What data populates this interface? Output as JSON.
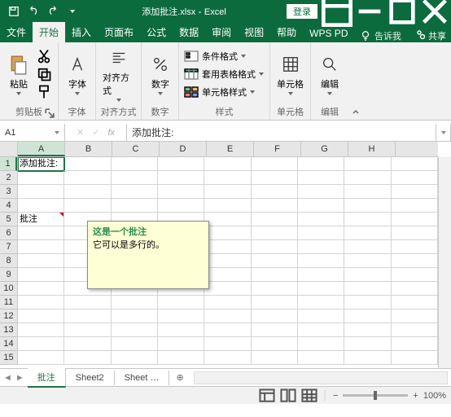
{
  "title": {
    "filename": "添加批注.xlsx",
    "app": "Excel",
    "login": "登录"
  },
  "tabs": {
    "file": "文件",
    "home": "开始",
    "insert": "插入",
    "layout": "页面布",
    "formulas": "公式",
    "data": "数据",
    "review": "审阅",
    "view": "视图",
    "help": "帮助",
    "wps": "WPS PD",
    "tellme": "告诉我",
    "share": "共享"
  },
  "ribbon": {
    "clipboard": {
      "paste": "粘贴",
      "label": "剪贴板"
    },
    "font": {
      "btn": "字体",
      "label": "字体"
    },
    "align": {
      "btn": "对齐方式",
      "label": "对齐方式"
    },
    "number": {
      "btn": "数字",
      "label": "数字"
    },
    "styles": {
      "cond": "条件格式",
      "table": "套用表格格式",
      "cell": "单元格样式",
      "label": "样式"
    },
    "cells": {
      "btn": "单元格",
      "label": "单元格"
    },
    "editing": {
      "btn": "编辑",
      "label": "编辑"
    }
  },
  "namebox": {
    "ref": "A1",
    "fx": "fx",
    "formula": "添加批注:"
  },
  "columns": [
    "A",
    "B",
    "C",
    "D",
    "E",
    "F",
    "G",
    "H"
  ],
  "rows": [
    "1",
    "2",
    "3",
    "4",
    "5",
    "6",
    "7",
    "8",
    "9",
    "10",
    "11",
    "12",
    "13",
    "14",
    "15"
  ],
  "cellA1": "添加批注:",
  "cellA5": "批注",
  "comment": {
    "author": "这是一个批注",
    "body": "它可以是多行的。"
  },
  "sheets": {
    "s1": "批注",
    "s2": "Sheet2",
    "s3": "Sheet",
    "dots": "…"
  },
  "status": {
    "zoom": "100%"
  },
  "chart_data": null
}
